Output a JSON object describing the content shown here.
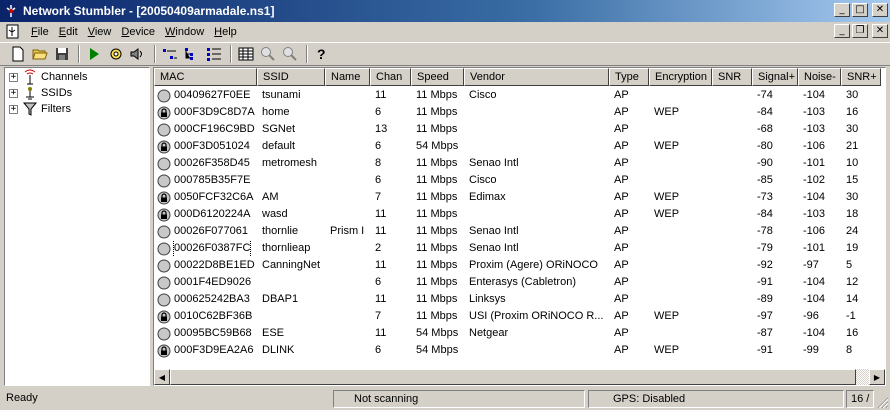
{
  "window": {
    "title": "Network Stumbler - [20050409armadale.ns1]"
  },
  "menu": [
    {
      "label": "File",
      "ul": "F",
      "rest": "ile"
    },
    {
      "label": "Edit",
      "ul": "E",
      "rest": "dit"
    },
    {
      "label": "View",
      "ul": "V",
      "rest": "iew"
    },
    {
      "label": "Device",
      "ul": "D",
      "rest": "evice"
    },
    {
      "label": "Window",
      "ul": "W",
      "rest": "indow"
    },
    {
      "label": "Help",
      "ul": "H",
      "rest": "elp"
    }
  ],
  "toolbar": [
    "new-file-icon",
    "open-folder-icon",
    "save-icon",
    "play-icon",
    "auto-configure-icon",
    "sound-icon",
    "list-view-icon",
    "tree-view-icon",
    "details-icon",
    "grid-view-icon",
    "zoom-in-icon",
    "zoom-out-icon",
    "help-icon"
  ],
  "tree": [
    {
      "label": "Channels",
      "icon": "channels-icon"
    },
    {
      "label": "SSIDs",
      "icon": "ssids-icon"
    },
    {
      "label": "Filters",
      "icon": "filters-icon"
    }
  ],
  "columns": [
    "MAC",
    "SSID",
    "Name",
    "Chan",
    "Speed",
    "Vendor",
    "Type",
    "Encryption",
    "SNR",
    "Signal+",
    "Noise-",
    "SNR+"
  ],
  "rows": [
    {
      "mac": "00409627F0EE",
      "ssid": "tsunami",
      "name": "",
      "chan": "11",
      "speed": "11 Mbps",
      "vendor": "Cisco",
      "type": "AP",
      "enc": "",
      "snr": "",
      "signal": "-74",
      "noise": "-104",
      "snrp": "30",
      "locked": false
    },
    {
      "mac": "000F3D9C8D7A",
      "ssid": "home",
      "name": "",
      "chan": "6",
      "speed": "11 Mbps",
      "vendor": "",
      "type": "AP",
      "enc": "WEP",
      "snr": "",
      "signal": "-84",
      "noise": "-103",
      "snrp": "16",
      "locked": true
    },
    {
      "mac": "000CF196C9BD",
      "ssid": "SGNet",
      "name": "",
      "chan": "13",
      "speed": "11 Mbps",
      "vendor": "",
      "type": "AP",
      "enc": "",
      "snr": "",
      "signal": "-68",
      "noise": "-103",
      "snrp": "30",
      "locked": false
    },
    {
      "mac": "000F3D051024",
      "ssid": "default",
      "name": "",
      "chan": "6",
      "speed": "54 Mbps",
      "vendor": "",
      "type": "AP",
      "enc": "WEP",
      "snr": "",
      "signal": "-80",
      "noise": "-106",
      "snrp": "21",
      "locked": true
    },
    {
      "mac": "00026F358D45",
      "ssid": "metromesh",
      "name": "",
      "chan": "8",
      "speed": "11 Mbps",
      "vendor": "Senao Intl",
      "type": "AP",
      "enc": "",
      "snr": "",
      "signal": "-90",
      "noise": "-101",
      "snrp": "10",
      "locked": false
    },
    {
      "mac": "000785B35F7E",
      "ssid": "",
      "name": "",
      "chan": "6",
      "speed": "11 Mbps",
      "vendor": "Cisco",
      "type": "AP",
      "enc": "",
      "snr": "",
      "signal": "-85",
      "noise": "-102",
      "snrp": "15",
      "locked": false
    },
    {
      "mac": "0050FCF32C6A",
      "ssid": "AM",
      "name": "",
      "chan": "7",
      "speed": "11 Mbps",
      "vendor": "Edimax",
      "type": "AP",
      "enc": "WEP",
      "snr": "",
      "signal": "-73",
      "noise": "-104",
      "snrp": "30",
      "locked": true
    },
    {
      "mac": "000D6120224A",
      "ssid": "wasd",
      "name": "",
      "chan": "11",
      "speed": "11 Mbps",
      "vendor": "",
      "type": "AP",
      "enc": "WEP",
      "snr": "",
      "signal": "-84",
      "noise": "-103",
      "snrp": "18",
      "locked": true
    },
    {
      "mac": "00026F077061",
      "ssid": "thornlie",
      "name": "Prism I",
      "chan": "11",
      "speed": "11 Mbps",
      "vendor": "Senao Intl",
      "type": "AP",
      "enc": "",
      "snr": "",
      "signal": "-78",
      "noise": "-106",
      "snrp": "24",
      "locked": false
    },
    {
      "mac": "00026F0387FC",
      "ssid": "thornlieap",
      "name": "",
      "chan": "2",
      "speed": "11 Mbps",
      "vendor": "Senao Intl",
      "type": "AP",
      "enc": "",
      "snr": "",
      "signal": "-79",
      "noise": "-101",
      "snrp": "19",
      "locked": false,
      "focus": true
    },
    {
      "mac": "00022D8BE1ED",
      "ssid": "CanningNet",
      "name": "",
      "chan": "11",
      "speed": "11 Mbps",
      "vendor": "Proxim (Agere) ORiNOCO",
      "type": "AP",
      "enc": "",
      "snr": "",
      "signal": "-92",
      "noise": "-97",
      "snrp": "5",
      "locked": false
    },
    {
      "mac": "0001F4ED9026",
      "ssid": "",
      "name": "",
      "chan": "6",
      "speed": "11 Mbps",
      "vendor": "Enterasys (Cabletron)",
      "type": "AP",
      "enc": "",
      "snr": "",
      "signal": "-91",
      "noise": "-104",
      "snrp": "12",
      "locked": false
    },
    {
      "mac": "000625242BA3",
      "ssid": "DBAP1",
      "name": "",
      "chan": "11",
      "speed": "11 Mbps",
      "vendor": "Linksys",
      "type": "AP",
      "enc": "",
      "snr": "",
      "signal": "-89",
      "noise": "-104",
      "snrp": "14",
      "locked": false
    },
    {
      "mac": "0010C62BF36B",
      "ssid": "",
      "name": "",
      "chan": "7",
      "speed": "11 Mbps",
      "vendor": "USI (Proxim ORiNOCO R...",
      "type": "AP",
      "enc": "WEP",
      "snr": "",
      "signal": "-97",
      "noise": "-96",
      "snrp": "-1",
      "locked": true
    },
    {
      "mac": "00095BC59B68",
      "ssid": "ESE",
      "name": "",
      "chan": "11",
      "speed": "54 Mbps",
      "vendor": "Netgear",
      "type": "AP",
      "enc": "",
      "snr": "",
      "signal": "-87",
      "noise": "-104",
      "snrp": "16",
      "locked": false
    },
    {
      "mac": "000F3D9EA2A6",
      "ssid": "DLINK",
      "name": "",
      "chan": "6",
      "speed": "54 Mbps",
      "vendor": "",
      "type": "AP",
      "enc": "WEP",
      "snr": "",
      "signal": "-91",
      "noise": "-99",
      "snrp": "8",
      "locked": true
    }
  ],
  "status": {
    "ready": "Ready",
    "scan": "Not scanning",
    "gps": "GPS: Disabled",
    "count": "16 /"
  }
}
